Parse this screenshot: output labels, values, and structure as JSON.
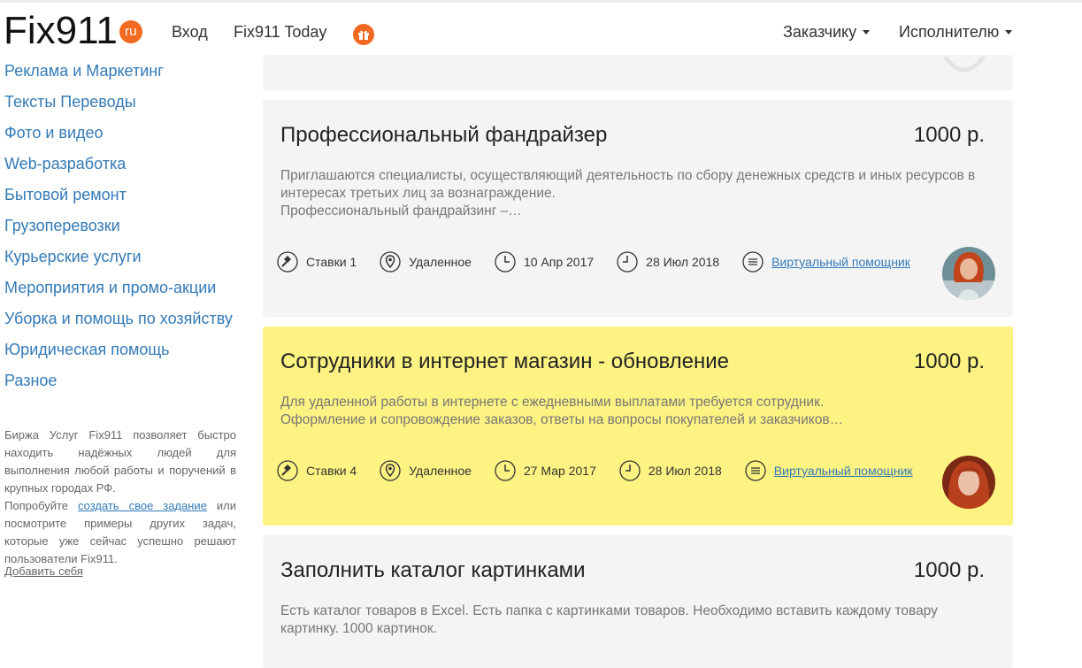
{
  "header": {
    "logo_text": "Fix911",
    "logo_badge": "ru",
    "nav": {
      "login": "Вход",
      "today": "Fix911 Today"
    },
    "gift_icon": "gift-icon",
    "dropdowns": {
      "customer": "Заказчику",
      "executor": "Исполнителю"
    }
  },
  "sidebar": {
    "categories": [
      "Реклама и Маркетинг",
      "Тексты Переводы",
      "Фото и видео",
      "Web-разработка",
      "Бытовой ремонт",
      "Грузоперевозки",
      "Курьерские услуги",
      "Мероприятия и промо-акции",
      "Уборка и помощь по хозяйству",
      "Юридическая помощь",
      "Разное"
    ],
    "about": {
      "text1": "Биржа Услуг Fix911 позволяет быстро находить надёжных людей для выполнения любой работы и поручений в крупных городах РФ.",
      "text2_pre": "Попробуйте ",
      "create_link": "создать свое задание",
      "text2_post": " или посмотрите примеры других задач, которые уже сейчас успешно решают пользователи Fix911.",
      "add_self": "Добавить себя"
    }
  },
  "tasks": [
    {
      "title": "Профессиональный фандрайзер",
      "price": "1000 р.",
      "description": "Приглашаются специалисты, осуществляющий деятельность по сбору денежных средств и иных ресурсов в интересах третьих лиц за вознаграждение.\nПрофессиональный фандрайзинг –…",
      "bids": "Ставки 1",
      "location": "Удаленное",
      "created": "10 Апр 2017",
      "deadline": "28 Июл 2018",
      "category": "Виртуальный помощник",
      "highlight": false
    },
    {
      "title": "Сотрудники в интернет магазин - обновление",
      "price": "1000 р.",
      "description": "Для удаленной работы в интернете с ежедневными выплатами требуется сотрудник.\nОформление и сопровождение заказов, ответы на вопросы покупателей и заказчиков…",
      "bids": "Ставки 4",
      "location": "Удаленное",
      "created": "27 Мар 2017",
      "deadline": "28 Июл 2018",
      "category": "Виртуальный помощник",
      "highlight": true
    },
    {
      "title": "Заполнить каталог картинками",
      "price": "1000 р.",
      "description": "Есть каталог товаров в Excel. Есть папка с картинками товаров. Необходимо вставить каждому товару картинку. 1000 картинок.",
      "highlight": false
    }
  ],
  "colors": {
    "accent": "#f26a21",
    "link": "#337ab7",
    "highlight": "#fdf382",
    "card": "#f4f4f4"
  }
}
